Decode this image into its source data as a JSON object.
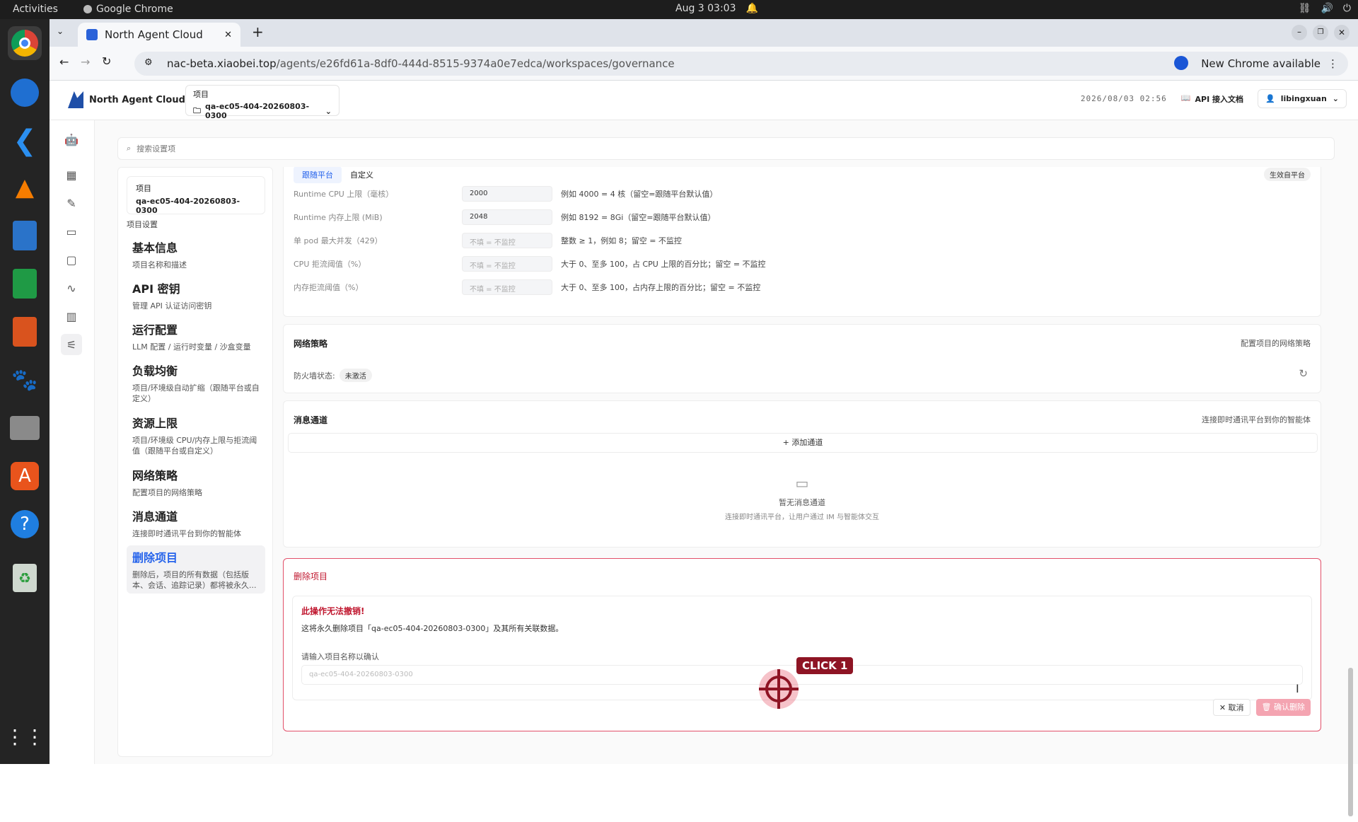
{
  "system": {
    "activities": "Activities",
    "app": "Google Chrome",
    "clock": "Aug 3  03:03"
  },
  "browser": {
    "tab_title": "North Agent Cloud",
    "url_host": "nac-beta.xiaobei.top",
    "url_path": "/agents/e26fd61a-8df0-444d-8515-9374a0e7edca/workspaces/governance",
    "new_chrome": "New Chrome available"
  },
  "header": {
    "brand": "North Agent Cloud",
    "project_label": "项目",
    "project_value": "qa-ec05-404-20260803-0300",
    "timestamp": "2026/08/03 02:56",
    "api_docs": "API 接入文档",
    "user": "libingxuan"
  },
  "search": {
    "placeholder": "搜索设置项"
  },
  "nav": {
    "project_label": "项目",
    "project_value": "qa-ec05-404-20260803-0300",
    "group": "项目设置",
    "items": [
      {
        "title": "基本信息",
        "desc": "项目名称和描述"
      },
      {
        "title": "API 密钥",
        "desc": "管理 API 认证访问密钥"
      },
      {
        "title": "运行配置",
        "desc": "LLM 配置 / 运行时变量 / 沙盒变量"
      },
      {
        "title": "负载均衡",
        "desc": "项目/环境级自动扩缩（跟随平台或自定义）"
      },
      {
        "title": "资源上限",
        "desc": "项目/环境级 CPU/内存上限与拒流阈值（跟随平台或自定义）"
      },
      {
        "title": "网络策略",
        "desc": "配置项目的网络策略"
      },
      {
        "title": "消息通道",
        "desc": "连接即时通讯平台到你的智能体"
      },
      {
        "title": "删除项目",
        "desc": "删除后，项目的所有数据（包括版本、会话、追踪记录）都将被永久..."
      }
    ]
  },
  "resource": {
    "seg_follow": "跟随平台",
    "seg_custom": "自定义",
    "effective": "生效自平台",
    "rows": [
      {
        "label": "Runtime CPU 上限（毫核）",
        "value": "2000",
        "hint": "例如 4000 = 4 核（留空=跟随平台默认值）"
      },
      {
        "label": "Runtime 内存上限 (MiB)",
        "value": "2048",
        "hint": "例如 8192 = 8Gi（留空=跟随平台默认值）"
      },
      {
        "label": "单 pod 最大并发（429）",
        "value": "不填 = 不监控",
        "hint": "整数 ≥ 1，例如 8；留空 = 不监控"
      },
      {
        "label": "CPU 拒流阈值（%）",
        "value": "不填 = 不监控",
        "hint": "大于 0、至多 100，占 CPU 上限的百分比；留空 = 不监控"
      },
      {
        "label": "内存拒流阈值（%）",
        "value": "不填 = 不监控",
        "hint": "大于 0、至多 100，占内存上限的百分比；留空 = 不监控"
      }
    ]
  },
  "network": {
    "title": "网络策略",
    "right": "配置项目的网络策略",
    "fw_label": "防火墙状态:",
    "fw_status": "未激活"
  },
  "channel": {
    "title": "消息通道",
    "right": "连接即时通讯平台到你的智能体",
    "add": "+ 添加通道",
    "empty_title": "暂无消息通道",
    "empty_desc": "连接即时通讯平台，让用户通过 IM 与智能体交互"
  },
  "delete": {
    "title": "删除项目",
    "warn": "此操作无法撤销!",
    "text": "这将永久删除项目「qa-ec05-404-20260803-0300」及其所有关联数据。",
    "confirm_label": "请输入项目名称以确认",
    "confirm_placeholder": "qa-ec05-404-20260803-0300",
    "cancel": "✕ 取消",
    "confirm": "确认删除"
  },
  "overlay": {
    "click_label": "CLICK 1"
  }
}
